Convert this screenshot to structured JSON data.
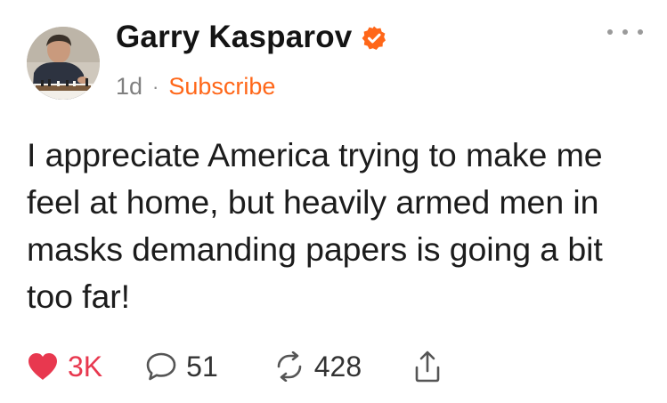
{
  "post": {
    "author": {
      "name": "Garry Kasparov",
      "verified_icon": "verified-check-icon",
      "avatar_icon": "avatar-photo"
    },
    "time_ago": "1d",
    "separator": "·",
    "subscribe_label": "Subscribe",
    "text": "I appreciate America trying to make me feel at home, but heavily armed men in masks demanding papers is going a bit too far!",
    "actions": {
      "likes": "3K",
      "comments": "51",
      "restacks": "428"
    }
  },
  "colors": {
    "accent": "#ff6719",
    "like": "#e8384f",
    "muted": "#808080"
  }
}
